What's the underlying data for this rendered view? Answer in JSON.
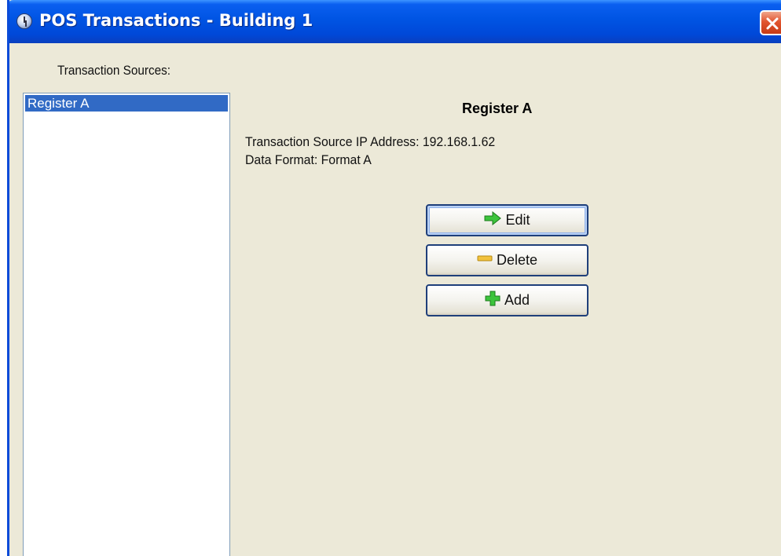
{
  "window": {
    "title": "POS Transactions - Building 1",
    "close_icon": "close-icon"
  },
  "sources": {
    "label": "Transaction Sources:",
    "items": [
      {
        "label": "Register A",
        "selected": true
      }
    ]
  },
  "details": {
    "title": "Register A",
    "ip_line": "Transaction Source IP Address: 192.168.1.62",
    "format_line": "Data Format: Format A"
  },
  "actions": {
    "edit_label": "Edit",
    "delete_label": "Delete",
    "add_label": "Add"
  },
  "colors": {
    "titlebar": "#0054e3",
    "selection": "#316ac5",
    "window_bg": "#ece9d8",
    "close_button": "#e2552f"
  }
}
